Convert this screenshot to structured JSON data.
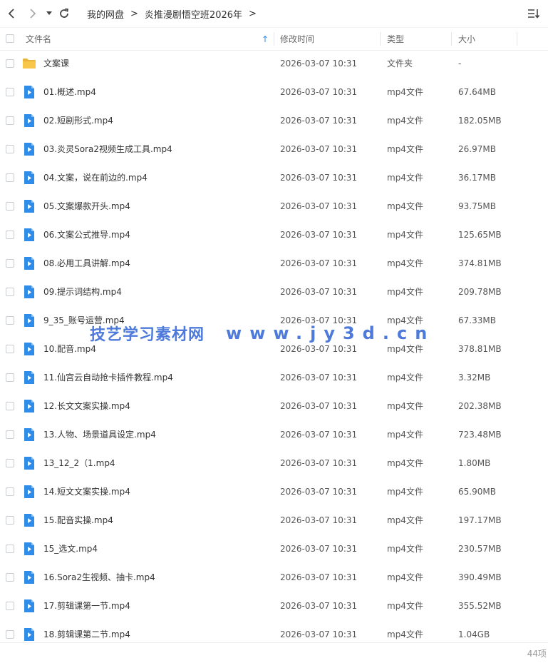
{
  "toolbar": {
    "back_icon": "chevron-left-icon",
    "forward_icon": "chevron-right-icon",
    "dropdown_icon": "caret-down-icon",
    "refresh_icon": "refresh-icon",
    "sort_icon": "list-sort-icon"
  },
  "breadcrumb": [
    "我的网盘",
    "炎推漫剧悟空班2026年"
  ],
  "breadcrumb_separator": ">",
  "columns": {
    "name": "文件名",
    "modified": "修改时间",
    "type": "类型",
    "size": "大小",
    "sort_indicator": "↑"
  },
  "files": [
    {
      "name": "文案课",
      "modified": "2026-03-07 10:31",
      "type": "文件夹",
      "size": "-",
      "icon": "folder-icon"
    },
    {
      "name": "01.概述.mp4",
      "modified": "2026-03-07 10:31",
      "type": "mp4文件",
      "size": "67.64MB",
      "icon": "video-file-icon"
    },
    {
      "name": "02.短剧形式.mp4",
      "modified": "2026-03-07 10:31",
      "type": "mp4文件",
      "size": "182.05MB",
      "icon": "video-file-icon"
    },
    {
      "name": "03.炎灵Sora2视频生成工具.mp4",
      "modified": "2026-03-07 10:31",
      "type": "mp4文件",
      "size": "26.97MB",
      "icon": "video-file-icon"
    },
    {
      "name": "04.文案，说在前边的.mp4",
      "modified": "2026-03-07 10:31",
      "type": "mp4文件",
      "size": "36.17MB",
      "icon": "video-file-icon"
    },
    {
      "name": "05.文案爆款开头.mp4",
      "modified": "2026-03-07 10:31",
      "type": "mp4文件",
      "size": "93.75MB",
      "icon": "video-file-icon"
    },
    {
      "name": "06.文案公式推导.mp4",
      "modified": "2026-03-07 10:31",
      "type": "mp4文件",
      "size": "125.65MB",
      "icon": "video-file-icon"
    },
    {
      "name": "08.必用工具讲解.mp4",
      "modified": "2026-03-07 10:31",
      "type": "mp4文件",
      "size": "374.81MB",
      "icon": "video-file-icon"
    },
    {
      "name": "09.提示词结构.mp4",
      "modified": "2026-03-07 10:31",
      "type": "mp4文件",
      "size": "209.78MB",
      "icon": "video-file-icon"
    },
    {
      "name": "9_35_账号运营.mp4",
      "modified": "2026-03-07 10:31",
      "type": "mp4文件",
      "size": "67.33MB",
      "icon": "video-file-icon"
    },
    {
      "name": "10.配音.mp4",
      "modified": "2026-03-07 10:31",
      "type": "mp4文件",
      "size": "378.81MB",
      "icon": "video-file-icon"
    },
    {
      "name": "11.仙宫云自动抢卡插件教程.mp4",
      "modified": "2026-03-07 10:31",
      "type": "mp4文件",
      "size": "3.32MB",
      "icon": "video-file-icon"
    },
    {
      "name": "12.长文文案实操.mp4",
      "modified": "2026-03-07 10:31",
      "type": "mp4文件",
      "size": "202.38MB",
      "icon": "video-file-icon"
    },
    {
      "name": "13.人物、场景道具设定.mp4",
      "modified": "2026-03-07 10:31",
      "type": "mp4文件",
      "size": "723.48MB",
      "icon": "video-file-icon"
    },
    {
      "name": "13_12_2（1.mp4",
      "modified": "2026-03-07 10:31",
      "type": "mp4文件",
      "size": "1.80MB",
      "icon": "video-file-icon"
    },
    {
      "name": "14.短文文案实操.mp4",
      "modified": "2026-03-07 10:31",
      "type": "mp4文件",
      "size": "65.90MB",
      "icon": "video-file-icon"
    },
    {
      "name": "15.配音实操.mp4",
      "modified": "2026-03-07 10:31",
      "type": "mp4文件",
      "size": "197.17MB",
      "icon": "video-file-icon"
    },
    {
      "name": "15_选文.mp4",
      "modified": "2026-03-07 10:31",
      "type": "mp4文件",
      "size": "230.57MB",
      "icon": "video-file-icon"
    },
    {
      "name": "16.Sora2生视频、抽卡.mp4",
      "modified": "2026-03-07 10:31",
      "type": "mp4文件",
      "size": "390.49MB",
      "icon": "video-file-icon"
    },
    {
      "name": "17.剪辑课第一节.mp4",
      "modified": "2026-03-07 10:31",
      "type": "mp4文件",
      "size": "355.52MB",
      "icon": "video-file-icon"
    },
    {
      "name": "18.剪辑课第二节.mp4",
      "modified": "2026-03-07 10:31",
      "type": "mp4文件",
      "size": "1.04GB",
      "icon": "video-file-icon"
    }
  ],
  "footer": {
    "item_count": "44项"
  },
  "watermark": {
    "text": "技艺学习素材网",
    "url": "www.jy3d.cn"
  },
  "colors": {
    "folder": "#f7c64a",
    "video_icon": "#2f8ce8",
    "watermark": "#3f6fd8",
    "header_text": "#666666",
    "sort_arrow": "#2f8ce8"
  }
}
